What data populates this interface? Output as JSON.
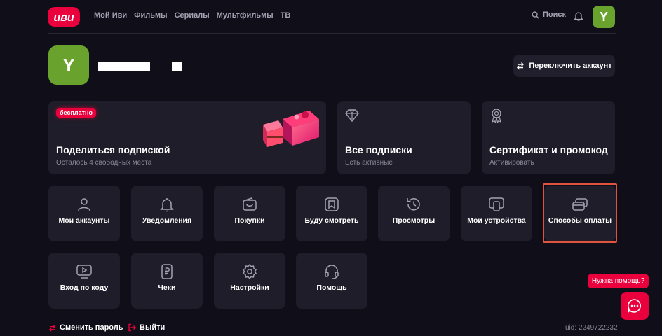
{
  "header": {
    "logo_text": "иви",
    "nav": [
      "Мой Иви",
      "Фильмы",
      "Сериалы",
      "Мультфильмы",
      "ТВ"
    ],
    "search_label": "Поиск",
    "avatar_letter": "Y"
  },
  "profile": {
    "avatar_letter": "Y",
    "switch_account_label": "Переключить аккаунт"
  },
  "cards": [
    {
      "title": "Поделиться подпиской",
      "subtitle": "Осталось 4 свободных места",
      "badge": "бесплатно"
    },
    {
      "title": "Все подписки",
      "subtitle": "Есть активные",
      "icon": "diamond-icon"
    },
    {
      "title": "Сертификат и промокод",
      "subtitle": "Активировать",
      "icon": "medal-icon"
    }
  ],
  "tiles": [
    {
      "label": "Мои аккаунты",
      "icon": "user-icon"
    },
    {
      "label": "Уведомления",
      "icon": "bell-icon"
    },
    {
      "label": "Покупки",
      "icon": "wallet-icon"
    },
    {
      "label": "Буду смотреть",
      "icon": "bookmark-icon"
    },
    {
      "label": "Просмотры",
      "icon": "history-icon"
    },
    {
      "label": "Мои устройства",
      "icon": "devices-icon"
    },
    {
      "label": "Способы оплаты",
      "icon": "cards-icon"
    },
    {
      "label": "Вход по коду",
      "icon": "tv-play-icon"
    },
    {
      "label": "Чеки",
      "icon": "receipt-icon"
    },
    {
      "label": "Настройки",
      "icon": "gear-icon"
    },
    {
      "label": "Помощь",
      "icon": "headset-icon"
    }
  ],
  "footer": {
    "change_password": "Сменить пароль",
    "logout": "Выйти",
    "uid": "uid: 2249722232"
  },
  "help": {
    "label": "Нужна помощь?"
  },
  "colors": {
    "background": "#100e19",
    "card": "#1f1d29",
    "accent": "#ea003d",
    "avatar": "#6aa22e",
    "highlight": "#e0533f"
  }
}
